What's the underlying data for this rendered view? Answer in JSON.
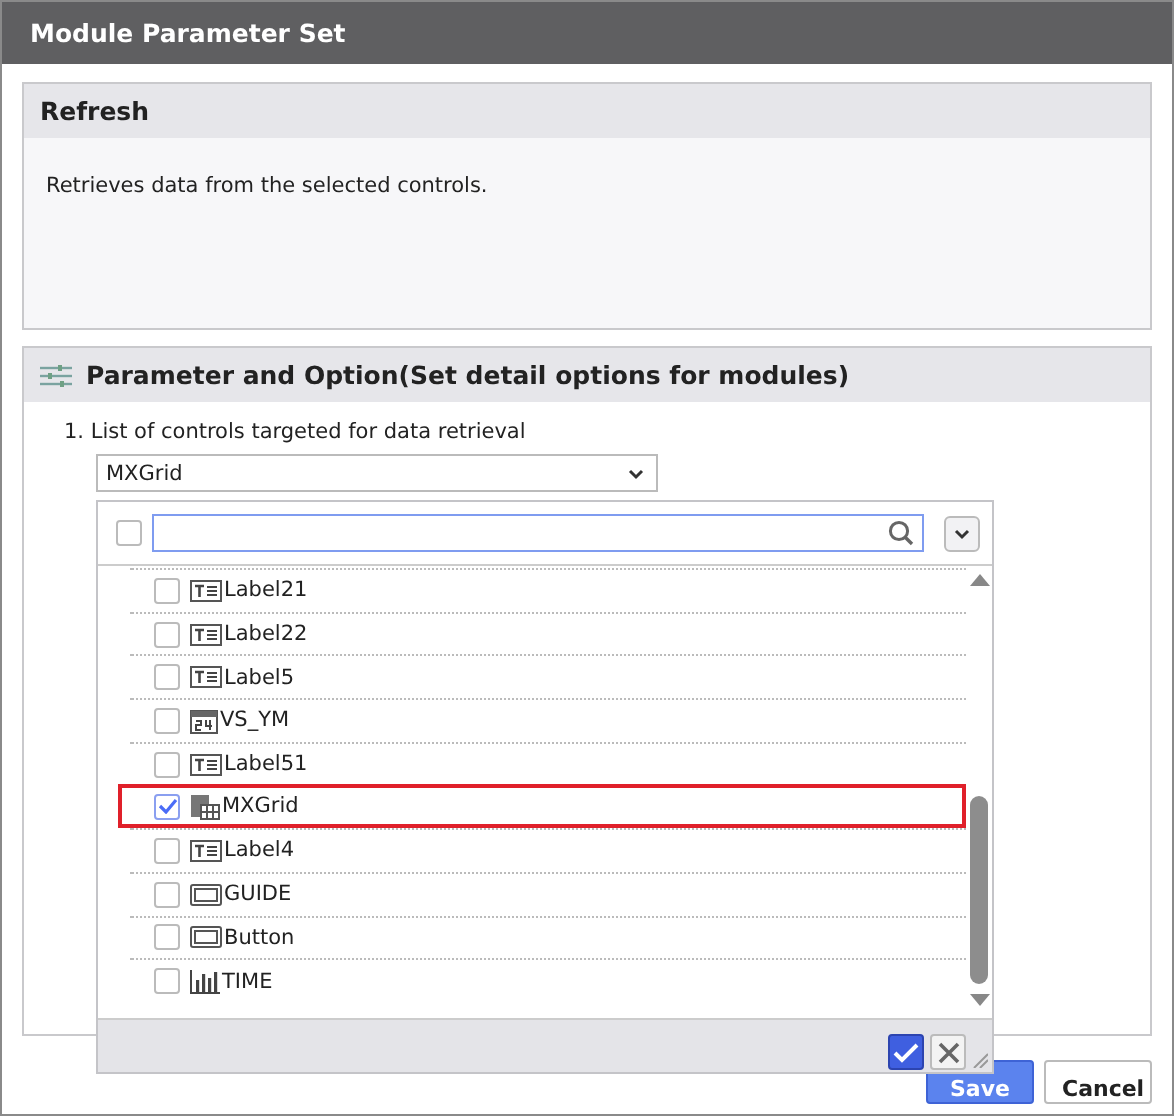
{
  "window": {
    "title": "Module Parameter Set"
  },
  "refresh_panel": {
    "title": "Refresh",
    "description": "Retrieves data from the selected controls."
  },
  "option_panel": {
    "title": "Parameter and Option(Set detail options for modules)",
    "item_label": "1. List of controls targeted for data retrieval",
    "select_value": "MXGrid"
  },
  "dropdown": {
    "select_all_checked": false,
    "items": [
      {
        "label": "Label21",
        "kind": "label",
        "checked": false,
        "highlighted": false
      },
      {
        "label": "Label22",
        "kind": "label",
        "checked": false,
        "highlighted": false
      },
      {
        "label": "Label5",
        "kind": "label",
        "checked": false,
        "highlighted": false
      },
      {
        "label": "VS_YM",
        "kind": "calendar",
        "checked": false,
        "highlighted": false
      },
      {
        "label": "Label51",
        "kind": "label",
        "checked": false,
        "highlighted": false
      },
      {
        "label": "MXGrid",
        "kind": "grid",
        "checked": true,
        "highlighted": true
      },
      {
        "label": "Label4",
        "kind": "label",
        "checked": false,
        "highlighted": false
      },
      {
        "label": "GUIDE",
        "kind": "button",
        "checked": false,
        "highlighted": false
      },
      {
        "label": "Button",
        "kind": "button",
        "checked": false,
        "highlighted": false
      },
      {
        "label": "TIME",
        "kind": "chart",
        "checked": false,
        "highlighted": false
      }
    ]
  },
  "buttons": [
    {
      "label": "Save",
      "kind": "primary"
    },
    {
      "label": "Cancel",
      "kind": "secondary"
    }
  ]
}
